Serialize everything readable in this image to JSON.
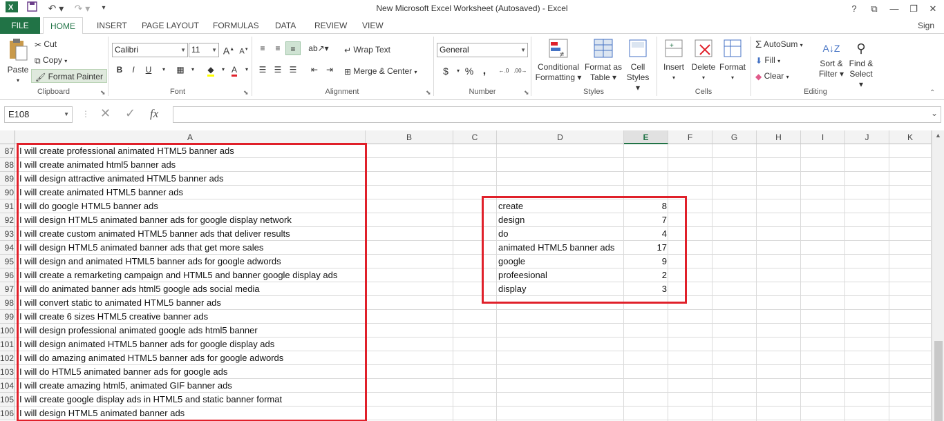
{
  "app": {
    "title": "New Microsoft Excel Worksheet (Autosaved) - Excel",
    "sign_in": "Sign in"
  },
  "window_controls": {
    "help": "?",
    "restore_ribbon": "⧉",
    "minimize": "—",
    "restore": "❐",
    "close": "✕"
  },
  "tabs": [
    "FILE",
    "HOME",
    "INSERT",
    "PAGE LAYOUT",
    "FORMULAS",
    "DATA",
    "REVIEW",
    "VIEW"
  ],
  "ribbon": {
    "clipboard": {
      "label": "Clipboard",
      "paste": "Paste",
      "cut": "Cut",
      "copy": "Copy",
      "format_painter": "Format Painter"
    },
    "font": {
      "label": "Font",
      "name": "Calibri",
      "size": "11",
      "bold": "B",
      "italic": "I",
      "underline": "U"
    },
    "alignment": {
      "label": "Alignment",
      "wrap_text": "Wrap Text",
      "merge_center": "Merge & Center"
    },
    "number": {
      "label": "Number",
      "format": "General",
      "currency": "$",
      "percent": "%",
      "comma": ","
    },
    "styles": {
      "label": "Styles",
      "conditional": "Conditional",
      "conditional2": "Formatting",
      "format_as": "Format as",
      "format_as2": "Table",
      "cell": "Cell",
      "cell2": "Styles"
    },
    "cells": {
      "label": "Cells",
      "insert": "Insert",
      "delete": "Delete",
      "format": "Format"
    },
    "editing": {
      "label": "Editing",
      "autosum": "AutoSum",
      "fill": "Fill",
      "clear": "Clear",
      "sort": "Sort &",
      "sort2": "Filter",
      "find": "Find &",
      "find2": "Select"
    }
  },
  "formula_bar": {
    "name_box": "E108",
    "fx": "fx",
    "value": ""
  },
  "columns": [
    "A",
    "B",
    "C",
    "D",
    "E",
    "F",
    "G",
    "H",
    "I",
    "J",
    "K"
  ],
  "active_column": "E",
  "rows": [
    {
      "n": "87",
      "a": "I will create professional animated HTML5 banner ads"
    },
    {
      "n": "88",
      "a": "I will create animated html5 banner ads"
    },
    {
      "n": "89",
      "a": "I will design attractive animated HTML5 banner ads"
    },
    {
      "n": "90",
      "a": "I will create animated HTML5 banner ads"
    },
    {
      "n": "91",
      "a": "I will do google HTML5 banner ads",
      "d": "create",
      "e": "8"
    },
    {
      "n": "92",
      "a": "I will design HTML5 animated banner ads for google display network",
      "d": "design",
      "e": "7"
    },
    {
      "n": "93",
      "a": "I will create custom animated HTML5 banner ads that deliver results",
      "d": "do",
      "e": "4"
    },
    {
      "n": "94",
      "a": "I will design HTML5 animated banner ads that get more sales",
      "d": "animated HTML5 banner ads",
      "e": "17"
    },
    {
      "n": "95",
      "a": "I will design and animated HTML5 banner ads for google adwords",
      "d": "google",
      "e": "9"
    },
    {
      "n": "96",
      "a": "I will create a remarketing campaign and HTML5 and banner google display ads",
      "d": "profeesional",
      "e": "2"
    },
    {
      "n": "97",
      "a": "I will do animated banner ads html5 google ads social media",
      "d": "display",
      "e": "3"
    },
    {
      "n": "98",
      "a": "I will convert static to animated HTML5 banner ads"
    },
    {
      "n": "99",
      "a": "I will create 6 sizes HTML5 creative banner ads"
    },
    {
      "n": "100",
      "a": "I will design professional animated google ads html5 banner"
    },
    {
      "n": "101",
      "a": "I will design animated HTML5 banner ads for google display ads"
    },
    {
      "n": "102",
      "a": "I will do amazing animated HTML5 banner ads for google adwords"
    },
    {
      "n": "103",
      "a": "I will do HTML5 animated banner ads for google ads"
    },
    {
      "n": "104",
      "a": "I will create amazing html5, animated GIF banner ads"
    },
    {
      "n": "105",
      "a": "I will create google display ads in HTML5 and static banner format"
    },
    {
      "n": "106",
      "a": "I will design HTML5 animated banner ads"
    }
  ],
  "colors": {
    "excel_green": "#217346",
    "highlight_red": "#e0202a"
  }
}
